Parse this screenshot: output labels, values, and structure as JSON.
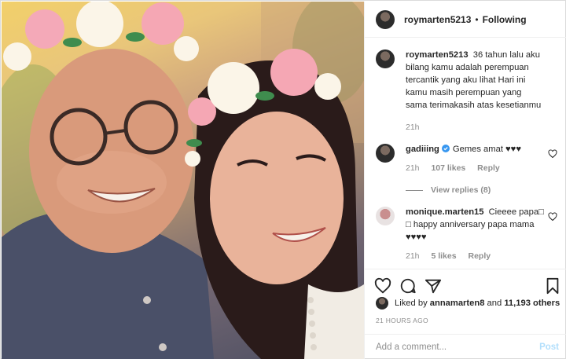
{
  "post": {
    "username": "roymarten5213",
    "separator": "•",
    "follow_status": "Following"
  },
  "caption": {
    "username": "roymarten5213",
    "text": "36 tahun lalu aku bilang kamu adalah perempuan tercantik yang aku lihat Hari ini kamu masih perempuan yang sama terimakasih atas kesetianmu",
    "time": "21h"
  },
  "comments": [
    {
      "username": "gadiiing",
      "verified": true,
      "text": "Gemes amat ♥♥♥",
      "time": "21h",
      "likes": "107 likes",
      "reply_label": "Reply",
      "view_replies": "View replies (8)"
    },
    {
      "username": "monique.marten15",
      "verified": false,
      "text": "Cieeee papa□ □ happy anniversary papa mama ♥♥♥♥",
      "time": "21h",
      "likes": "5 likes",
      "reply_label": "Reply"
    }
  ],
  "likes": {
    "prefix": "Liked by",
    "user": "annamarten8",
    "joiner": "and",
    "others": "11,193 others"
  },
  "timestamp": "21 HOURS AGO",
  "add_comment": {
    "placeholder": "Add a comment...",
    "post_label": "Post"
  },
  "icons": [
    "heart-icon",
    "comment-icon",
    "share-icon",
    "bookmark-icon",
    "verified-icon"
  ],
  "colors": {
    "text": "#262626",
    "muted": "#8e8e8e",
    "verified": "#3897f0",
    "post_disabled": "#b2dffc"
  }
}
